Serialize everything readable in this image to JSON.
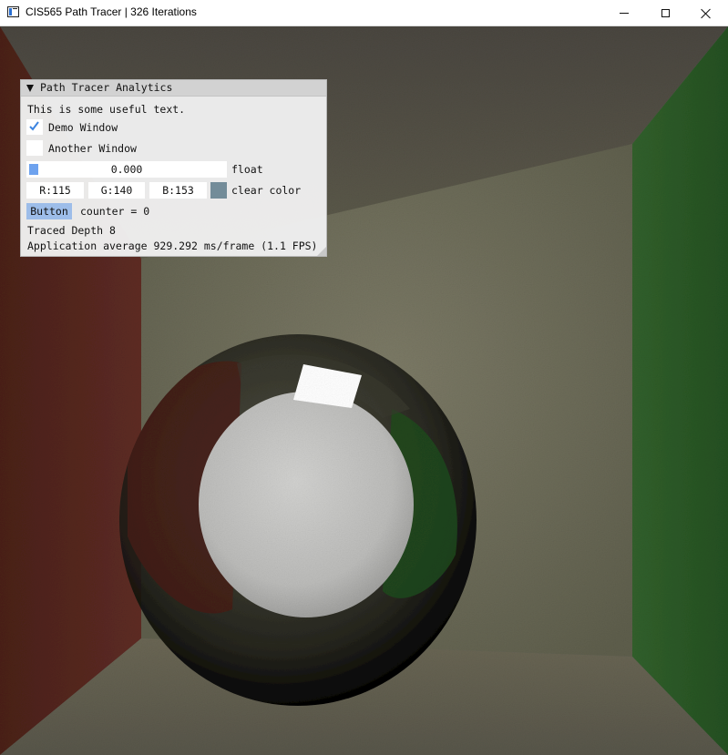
{
  "window": {
    "title": "CIS565 Path Tracer | 326 Iterations",
    "icon": "app-window-icon",
    "controls": [
      "minimize-icon",
      "maximize-icon",
      "close-icon"
    ]
  },
  "imgui": {
    "title": "Path Tracer Analytics",
    "text": "This is some useful text.",
    "checkbox_demo": {
      "label": "Demo Window",
      "checked": true
    },
    "checkbox_another": {
      "label": "Another Window",
      "checked": false
    },
    "slider": {
      "value": "0.000",
      "label": "float"
    },
    "clear_color": {
      "r": "R:115",
      "g": "G:140",
      "b": "B:153",
      "label": "clear color",
      "swatch": "#738c99"
    },
    "button_label": "Button",
    "counter": "counter = 0",
    "traced_depth": "Traced Depth 8",
    "fps": "Application average 929.292 ms/frame (1.1 FPS)"
  },
  "scene_colors": {
    "left_wall": "#5a2a22",
    "right_wall": "#2f5a2a",
    "back_wall": "#6c6a58",
    "sphere_glass": "#1e1e1a",
    "sphere_inner": "#c2c2c0",
    "accent": "#6ea2ee"
  }
}
